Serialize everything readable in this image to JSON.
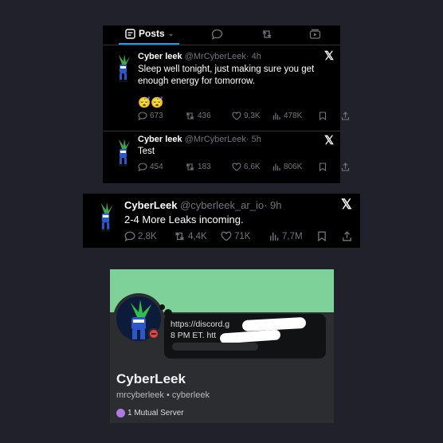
{
  "panel1": {
    "tabs": {
      "posts_label": "Posts"
    },
    "tweets": [
      {
        "name": "Cyber leek",
        "handle": "@MrCyberLeek",
        "time": "· 4h",
        "text_line1": "Sleep well tonight, just making sure you get",
        "text_line2": "enough energy for tomorrow.",
        "emoji": "😴😴",
        "replies": "673",
        "reposts": "436",
        "likes": "9,3K",
        "views": "478K"
      },
      {
        "name": "Cyber leek",
        "handle": "@MrCyberLeek",
        "time": "· 5h",
        "text_line1": "Test",
        "replies": "454",
        "reposts": "183",
        "likes": "6,6K",
        "views": "806K"
      }
    ]
  },
  "panel2": {
    "name": "CyberLeek",
    "handle": "@cyberleek_ar_io",
    "time": "· 9h",
    "text": "2-4 More Leaks incoming.",
    "replies": "2,8K",
    "reposts": "4,4K",
    "likes": "71K",
    "views": "7,7M"
  },
  "discord": {
    "status_line1": "https://discord.g",
    "status_line2": "8 PM ET. htt",
    "display_name": "CyberLeek",
    "username_line": "mrcyberleek • cyberleek",
    "mutual": "1 Mutual Server",
    "banner_color": "#7fd19a"
  },
  "x_logo": "𝕏",
  "colors": {
    "accent": "#1d9bf0",
    "muted": "#71767b",
    "dnd": "#f23f43"
  }
}
